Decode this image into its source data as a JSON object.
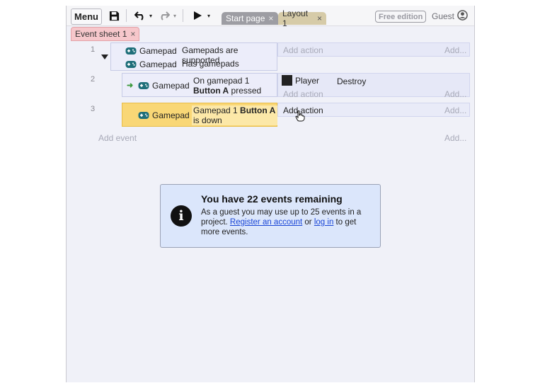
{
  "toolbar": {
    "menu_label": "Menu",
    "tabs": [
      {
        "label": "Start page",
        "close": "×"
      },
      {
        "label": "Layout 1",
        "close": "×"
      }
    ],
    "free_edition": "Free edition",
    "guest": "Guest"
  },
  "sheet_tab": {
    "label": "Event sheet 1",
    "close": "×"
  },
  "events": [
    {
      "number": "1",
      "conditions": [
        {
          "object": "Gamepad",
          "text": "Gamepads are supported"
        },
        {
          "object": "Gamepad",
          "text": "Has gamepads"
        }
      ],
      "add_action": "Add action",
      "add_dots": "Add..."
    },
    {
      "number": "2",
      "conditions": [
        {
          "object": "Gamepad",
          "text_plain": "On gamepad 1 ",
          "text_bold": "Button A",
          "text_tail": " pressed"
        }
      ],
      "actions": [
        {
          "object": "Player",
          "text": "Destroy"
        }
      ],
      "add_action": "Add action",
      "add_dots": "Add..."
    },
    {
      "number": "3",
      "conditions": [
        {
          "object": "Gamepad",
          "text_plain": "Gamepad 1 ",
          "text_bold": "Button A",
          "text_tail": " is down"
        }
      ],
      "add_action": "Add action",
      "add_dots": "Add..."
    }
  ],
  "add_event": "Add event",
  "add_event_dots": "Add...",
  "notice": {
    "title": "You have 22 events remaining",
    "body_1": "As a guest you may use up to 25 events in a project. ",
    "link_register": "Register an account",
    "body_2": " or ",
    "link_login": "log in",
    "body_3": " to get more events."
  },
  "colors": {
    "highlight": "#f9d776",
    "condition_bg": "#ecedfa",
    "notice_bg": "#dbe6fb",
    "link": "#1a46d6",
    "gamepad_icon": "#1f6f7a"
  }
}
